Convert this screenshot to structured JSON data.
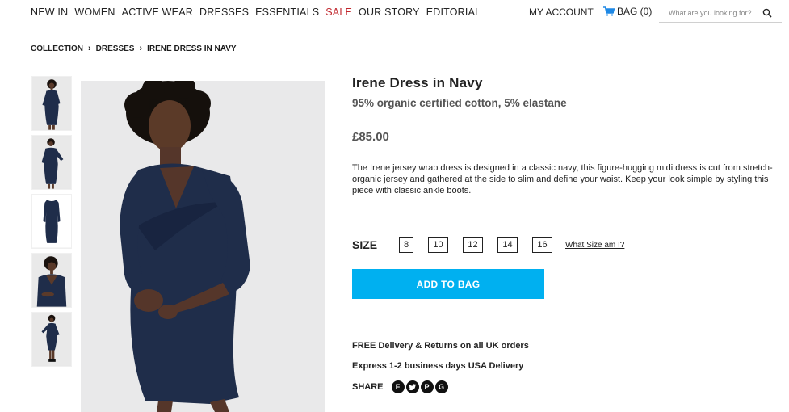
{
  "nav": {
    "items": [
      {
        "label": "New In",
        "sale": false
      },
      {
        "label": "Women",
        "sale": false
      },
      {
        "label": "Active Wear",
        "sale": false
      },
      {
        "label": "Dresses",
        "sale": false
      },
      {
        "label": "Essentials",
        "sale": false
      },
      {
        "label": "Sale",
        "sale": true
      },
      {
        "label": "Our Story",
        "sale": false
      },
      {
        "label": "Editorial",
        "sale": false
      }
    ],
    "account_label": "My Account",
    "bag_label": "Bag (0)",
    "bag_icon": "shopping-cart-icon",
    "search_placeholder": "What are you looking for?",
    "search_icon": "search-icon"
  },
  "breadcrumb": [
    "Collection",
    "Dresses",
    "Irene Dress in Navy"
  ],
  "product": {
    "title": "Irene Dress in Navy",
    "composition": "95% organic certified cotton, 5% elastane",
    "price": "£85.00",
    "description": "The Irene jersey wrap dress is designed in a classic navy, this figure-hugging midi dress is cut from stretch-organic jersey and gathered at the side to slim and define your waist. Keep your look simple by styling this piece with classic ankle boots.",
    "size_label": "Size",
    "sizes": [
      "8",
      "10",
      "12",
      "14",
      "16"
    ],
    "size_guide_label": "What Size am I?",
    "add_to_bag_label": "Add to Bag",
    "delivery_uk": "FREE Delivery & Returns on all UK orders",
    "delivery_usa": "Express 1-2 business days USA Delivery",
    "share_label": "Share",
    "share_icons": [
      "facebook-icon",
      "twitter-icon",
      "pinterest-icon",
      "google-plus-icon"
    ]
  },
  "colors": {
    "accent": "#00b0f0",
    "sale": "#c0272d",
    "dress": "#1f2d4a"
  }
}
